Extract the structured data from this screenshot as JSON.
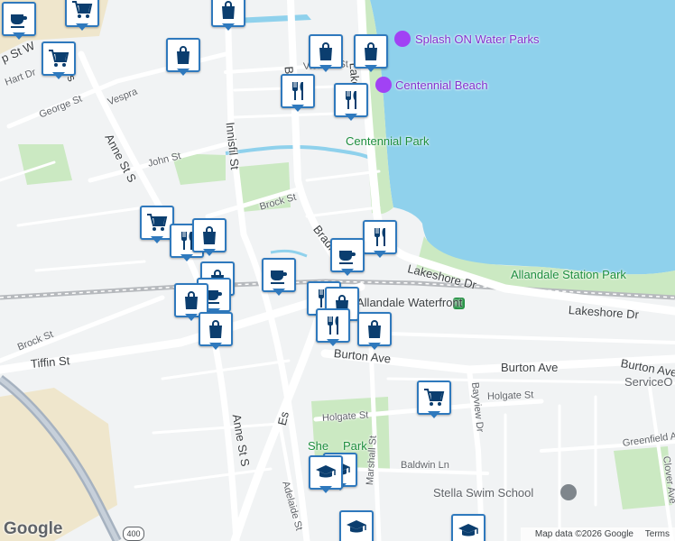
{
  "map": {
    "colors": {
      "water": "#8fd1ec",
      "park": "#cbe9c2",
      "road": "#ffffff",
      "highway": "#a6b2c0",
      "rail": "#b6b9bd",
      "marker_border": "#2f79bd"
    },
    "places": [
      {
        "name": "Splash ON Water Parks",
        "kind": "purple"
      },
      {
        "name": "Centennial Beach",
        "kind": "purple"
      },
      {
        "name": "Centennial Park",
        "kind": "green"
      },
      {
        "name": "Allandale Station Park",
        "kind": "green"
      },
      {
        "name": "Allandale Waterfront",
        "kind": "dark"
      },
      {
        "name": "ServiceO",
        "kind": "grey"
      },
      {
        "name": "Stella Swim School",
        "kind": "grey"
      },
      {
        "name": "She",
        "kind": "green"
      },
      {
        "name": "Park",
        "kind": "green"
      }
    ],
    "streets": {
      "lakeshore_dr_1": "Lakeshore Dr",
      "lakeshore_dr_2": "Lakeshore Dr",
      "burton_ave_1": "Burton Ave",
      "burton_ave_2": "Burton Ave",
      "burton_ave_3": "Burton Ave",
      "tiffin_st": "Tiffin St",
      "brock_st_1": "Brock St",
      "brock_st_2": "Brock St",
      "innisfil_st": "Innisfil St",
      "anne_st_s_1": "Anne St S",
      "anne_st_s_2": "Anne St S",
      "john_st": "John St",
      "george_st": "George St",
      "vespra_st": "Vespra",
      "hart_dr": "Hart Dr",
      "victoria_st": "Victoria St",
      "holgate_st_1": "Holgate St",
      "holgate_st_2": "Holgate St",
      "baldwin_ln": "Baldwin Ln",
      "adelaide_st": "Adelaide St",
      "marshall_st": "Marshall St",
      "bayview_dr": "Bayview Dr",
      "greenfield_ave": "Greenfield Ave",
      "clover_ave": "Clover Ave",
      "bradford_1": "Bradf",
      "bradford_2": "Br",
      "lakeshore_short": "Lakes",
      "essa_rd": "Es",
      "anne_st_n": "Anne St",
      "p_st_w": "p St W",
      "s_label": "s"
    },
    "highway_shield": "400",
    "markers": [
      {
        "type": "cafe"
      },
      {
        "type": "shopping"
      },
      {
        "type": "shopping"
      },
      {
        "type": "shopping"
      },
      {
        "type": "shopping"
      },
      {
        "type": "grocery"
      },
      {
        "type": "restaurant"
      },
      {
        "type": "restaurant"
      },
      {
        "type": "grocery"
      },
      {
        "type": "restaurant"
      },
      {
        "type": "shopping"
      },
      {
        "type": "restaurant"
      },
      {
        "type": "cafe"
      },
      {
        "type": "cafe"
      },
      {
        "type": "shopping"
      },
      {
        "type": "cafe"
      },
      {
        "type": "shopping"
      },
      {
        "type": "restaurant"
      },
      {
        "type": "shopping"
      },
      {
        "type": "restaurant"
      },
      {
        "type": "shopping"
      },
      {
        "type": "shopping"
      },
      {
        "type": "grocery"
      },
      {
        "type": "school"
      },
      {
        "type": "school"
      },
      {
        "type": "school"
      },
      {
        "type": "school"
      },
      {
        "type": "grocery"
      }
    ],
    "attribution": {
      "logo": "Google",
      "map_data": "Map data ©2026 Google",
      "terms": "Terms"
    }
  }
}
